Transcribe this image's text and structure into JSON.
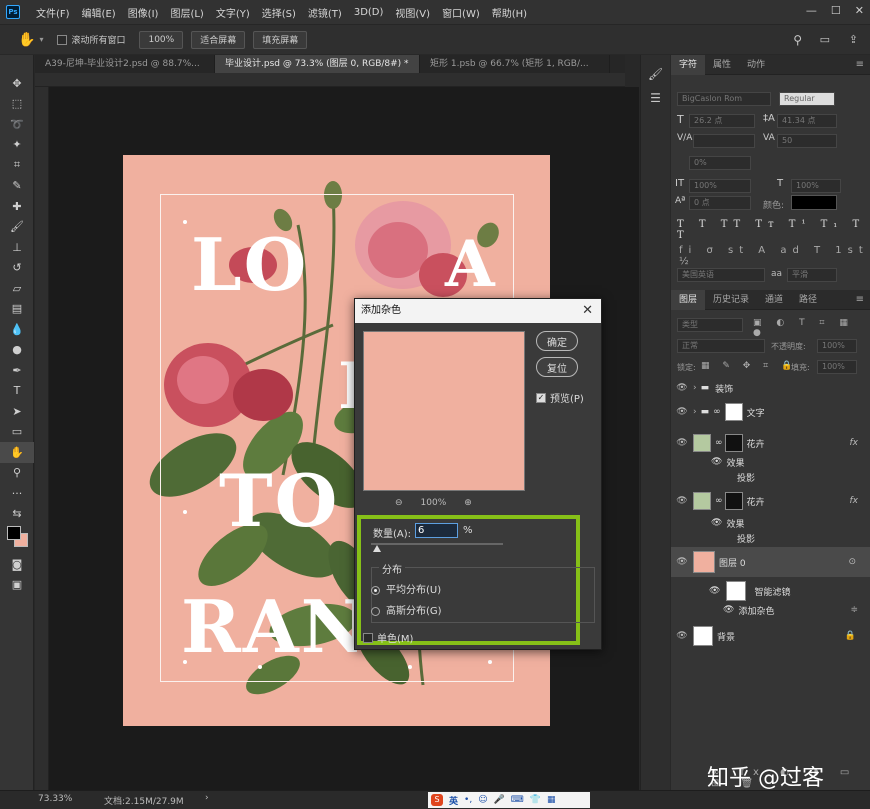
{
  "menubar": {
    "logo": "Ps",
    "items": [
      "文件(F)",
      "编辑(E)",
      "图像(I)",
      "图层(L)",
      "文字(Y)",
      "选择(S)",
      "滤镜(T)",
      "3D(D)",
      "视图(V)",
      "窗口(W)",
      "帮助(H)"
    ]
  },
  "options": {
    "scroll_all": "滚动所有窗口",
    "zoom": "100%",
    "fit_screen": "适合屏幕",
    "fill_screen": "填充屏幕"
  },
  "tabs": [
    "A39-尼坤-毕业设计2.psd @ 88.7%...",
    "毕业设计.psd @ 73.3% (图层 0, RGB/8#) *",
    "矩形 1.psb @ 66.7% (矩形 1, RGB/..."
  ],
  "artwork": {
    "line1": "LO",
    "line1b": "A",
    "line2": "I",
    "line3": "TO",
    "line4": "RAN",
    "bg": "#f0b09f"
  },
  "dialog": {
    "title": "添加杂色",
    "ok": "确定",
    "reset": "复位",
    "preview_label": "预览(P)",
    "zoom": "100%",
    "amount_label": "数量(A):",
    "amount_value": "6",
    "amount_unit": "%",
    "distribution_label": "分布",
    "uniform": "平均分布(U)",
    "gaussian": "高斯分布(G)",
    "mono": "单色(M)"
  },
  "char_panel": {
    "tabs": [
      "字符",
      "属性",
      "动作"
    ],
    "font": "BigCaslon Rom",
    "style": "Regular",
    "size": "26.2 点",
    "leading": "41.34 点",
    "tracking": "50",
    "scale_pct": "0%",
    "vscale": "100%",
    "hscale": "100%",
    "baseline": "0 点",
    "color_label": "颜色:",
    "lang": "美国英语",
    "aa": "平滑",
    "aa_label": "aa"
  },
  "layers_panel": {
    "tabs": [
      "图层",
      "历史记录",
      "通道",
      "路径"
    ],
    "filter": "类型",
    "blend": "正常",
    "opacity_label": "不透明度:",
    "opacity": "100%",
    "lock_label": "锁定:",
    "fill_label": "填充:",
    "fill": "100%",
    "layers": [
      {
        "name": "装饰",
        "kind": "group"
      },
      {
        "name": "文字",
        "kind": "group"
      },
      {
        "name": "花卉",
        "kind": "layer",
        "fx": "fx"
      },
      {
        "name": "效果",
        "kind": "sub"
      },
      {
        "name": "投影",
        "kind": "subsub"
      },
      {
        "name": "花卉",
        "kind": "layer",
        "fx": "fx"
      },
      {
        "name": "效果",
        "kind": "sub"
      },
      {
        "name": "投影",
        "kind": "subsub"
      },
      {
        "name": "图层 0",
        "kind": "smart"
      },
      {
        "name": "智能滤镜",
        "kind": "sub"
      },
      {
        "name": "添加杂色",
        "kind": "subsub"
      },
      {
        "name": "背景",
        "kind": "bg"
      }
    ]
  },
  "status": {
    "zoom": "73.33%",
    "doc": "文档:2.15M/27.9M"
  },
  "watermark": "知乎 @过客",
  "ime": "英"
}
